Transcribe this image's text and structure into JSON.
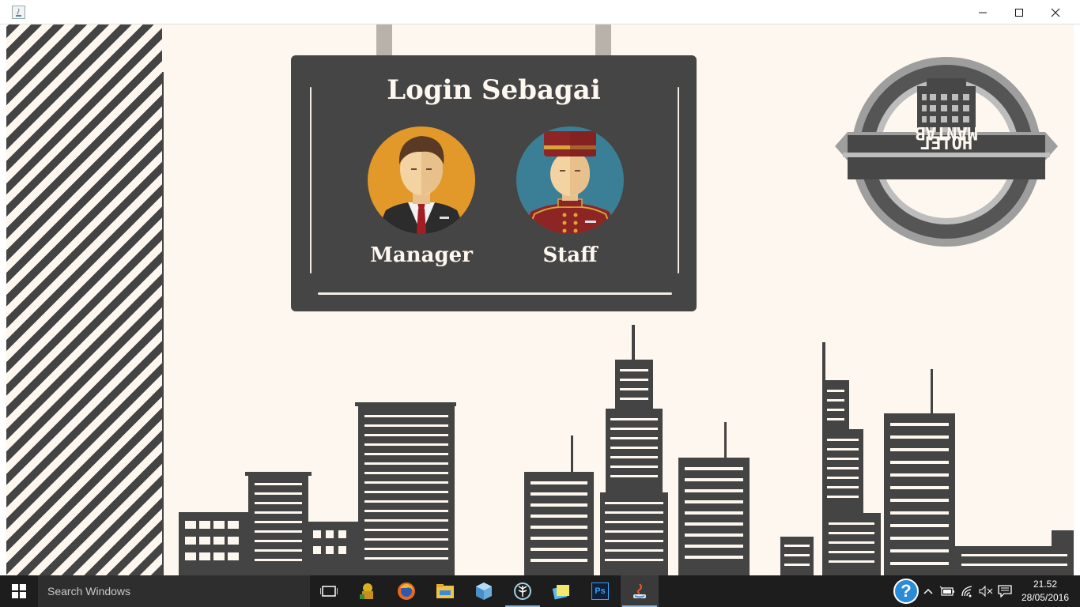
{
  "window": {
    "title": "",
    "buttons": {
      "minimize": "minimize",
      "maximize": "maximize",
      "close": "close"
    }
  },
  "sign": {
    "title": "Login Sebagai",
    "roles": [
      {
        "label": "Manager",
        "avatar_color": "#e2992a"
      },
      {
        "label": "Staff",
        "avatar_color": "#3b7f96"
      }
    ]
  },
  "logo": {
    "line1": "HOTEL",
    "line2": "MANTAB"
  },
  "taskbar": {
    "search_placeholder": "Search Windows",
    "apps": [
      "task-view",
      "game",
      "firefox",
      "file-explorer",
      "3d-box",
      "tree-app",
      "sticky-notes",
      "photoshop",
      "java"
    ],
    "photoshop_label": "Ps",
    "help_label": "?",
    "clock": {
      "time": "21.52",
      "date": "28/05/2016"
    }
  },
  "colors": {
    "sign": "#464545",
    "background": "#fdf7ef",
    "buildings": "#444444",
    "taskbar": "#1d1d1d"
  }
}
